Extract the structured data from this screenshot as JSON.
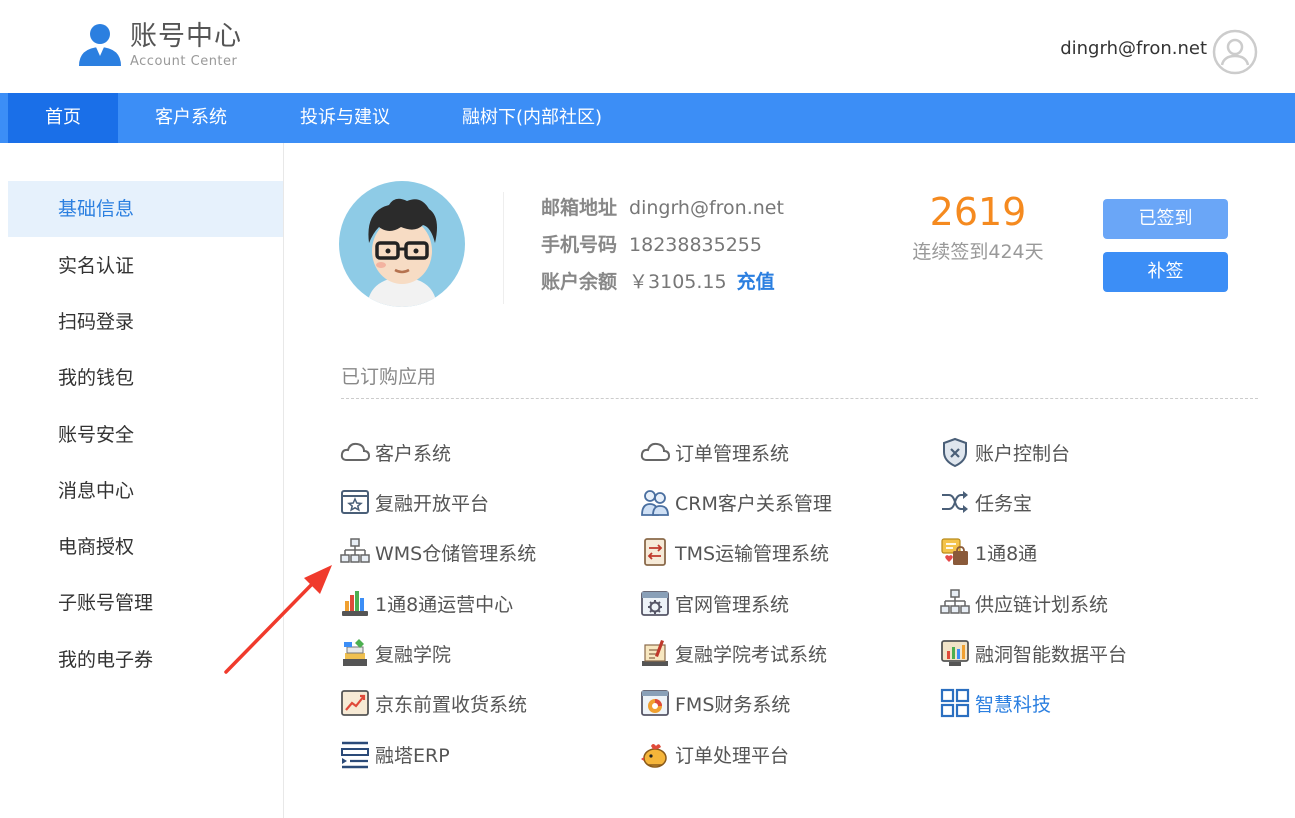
{
  "header": {
    "logo_title": "账号中心",
    "logo_subtitle": "Account Center",
    "user_email": "dingrh@fron.net"
  },
  "nav": {
    "items": [
      {
        "label": "首页",
        "active": true
      },
      {
        "label": "客户系统",
        "active": false
      },
      {
        "label": "投诉与建议",
        "active": false
      },
      {
        "label": "融树下(内部社区)",
        "active": false
      }
    ]
  },
  "sidebar": {
    "items": [
      {
        "label": "基础信息",
        "active": true
      },
      {
        "label": "实名认证"
      },
      {
        "label": "扫码登录"
      },
      {
        "label": "我的钱包"
      },
      {
        "label": "账号安全"
      },
      {
        "label": "消息中心"
      },
      {
        "label": "电商授权"
      },
      {
        "label": "子账号管理"
      },
      {
        "label": "我的电子券"
      }
    ]
  },
  "profile": {
    "email_label": "邮箱地址",
    "email_value": "dingrh@fron.net",
    "phone_label": "手机号码",
    "phone_value": "18238835255",
    "balance_label": "账户余额",
    "balance_value": "￥3105.15",
    "recharge_label": "充值"
  },
  "checkin": {
    "points": "2619",
    "streak_text": "连续签到424天",
    "signed_label": "已签到",
    "makeup_label": "补签"
  },
  "apps": {
    "section_title": "已订购应用",
    "items": [
      {
        "label": "客户系统",
        "icon": "cloud-icon"
      },
      {
        "label": "订单管理系统",
        "icon": "cloud-icon"
      },
      {
        "label": "账户控制台",
        "icon": "shield-icon"
      },
      {
        "label": "复融开放平台",
        "icon": "browser-star-icon"
      },
      {
        "label": "CRM客户关系管理",
        "icon": "users-icon"
      },
      {
        "label": "任务宝",
        "icon": "shuffle-icon"
      },
      {
        "label": "WMS仓储管理系统",
        "icon": "org-chart-icon"
      },
      {
        "label": "TMS运输管理系统",
        "icon": "document-arrows-icon"
      },
      {
        "label": "1通8通",
        "icon": "chat-bag-icon"
      },
      {
        "label": "1通8通运营中心",
        "icon": "bar-chart-icon"
      },
      {
        "label": "官网管理系统",
        "icon": "browser-gear-icon"
      },
      {
        "label": "供应链计划系统",
        "icon": "org-chart-icon"
      },
      {
        "label": "复融学院",
        "icon": "books-icon"
      },
      {
        "label": "复融学院考试系统",
        "icon": "exam-icon"
      },
      {
        "label": "融洞智能数据平台",
        "icon": "dashboard-icon"
      },
      {
        "label": "京东前置收货系统",
        "icon": "line-chart-icon"
      },
      {
        "label": "FMS财务系统",
        "icon": "pie-window-icon"
      },
      {
        "label": "智慧科技",
        "icon": "grid-icon",
        "highlight": true
      },
      {
        "label": "融塔ERP",
        "icon": "list-icon"
      },
      {
        "label": "订单处理平台",
        "icon": "chick-icon"
      }
    ]
  },
  "colors": {
    "primary": "#3c8ef6",
    "nav_active": "#1a6fe8",
    "accent_orange": "#f58a1f",
    "link_blue": "#2b7fe0",
    "arrow_red": "#f03a2c"
  }
}
